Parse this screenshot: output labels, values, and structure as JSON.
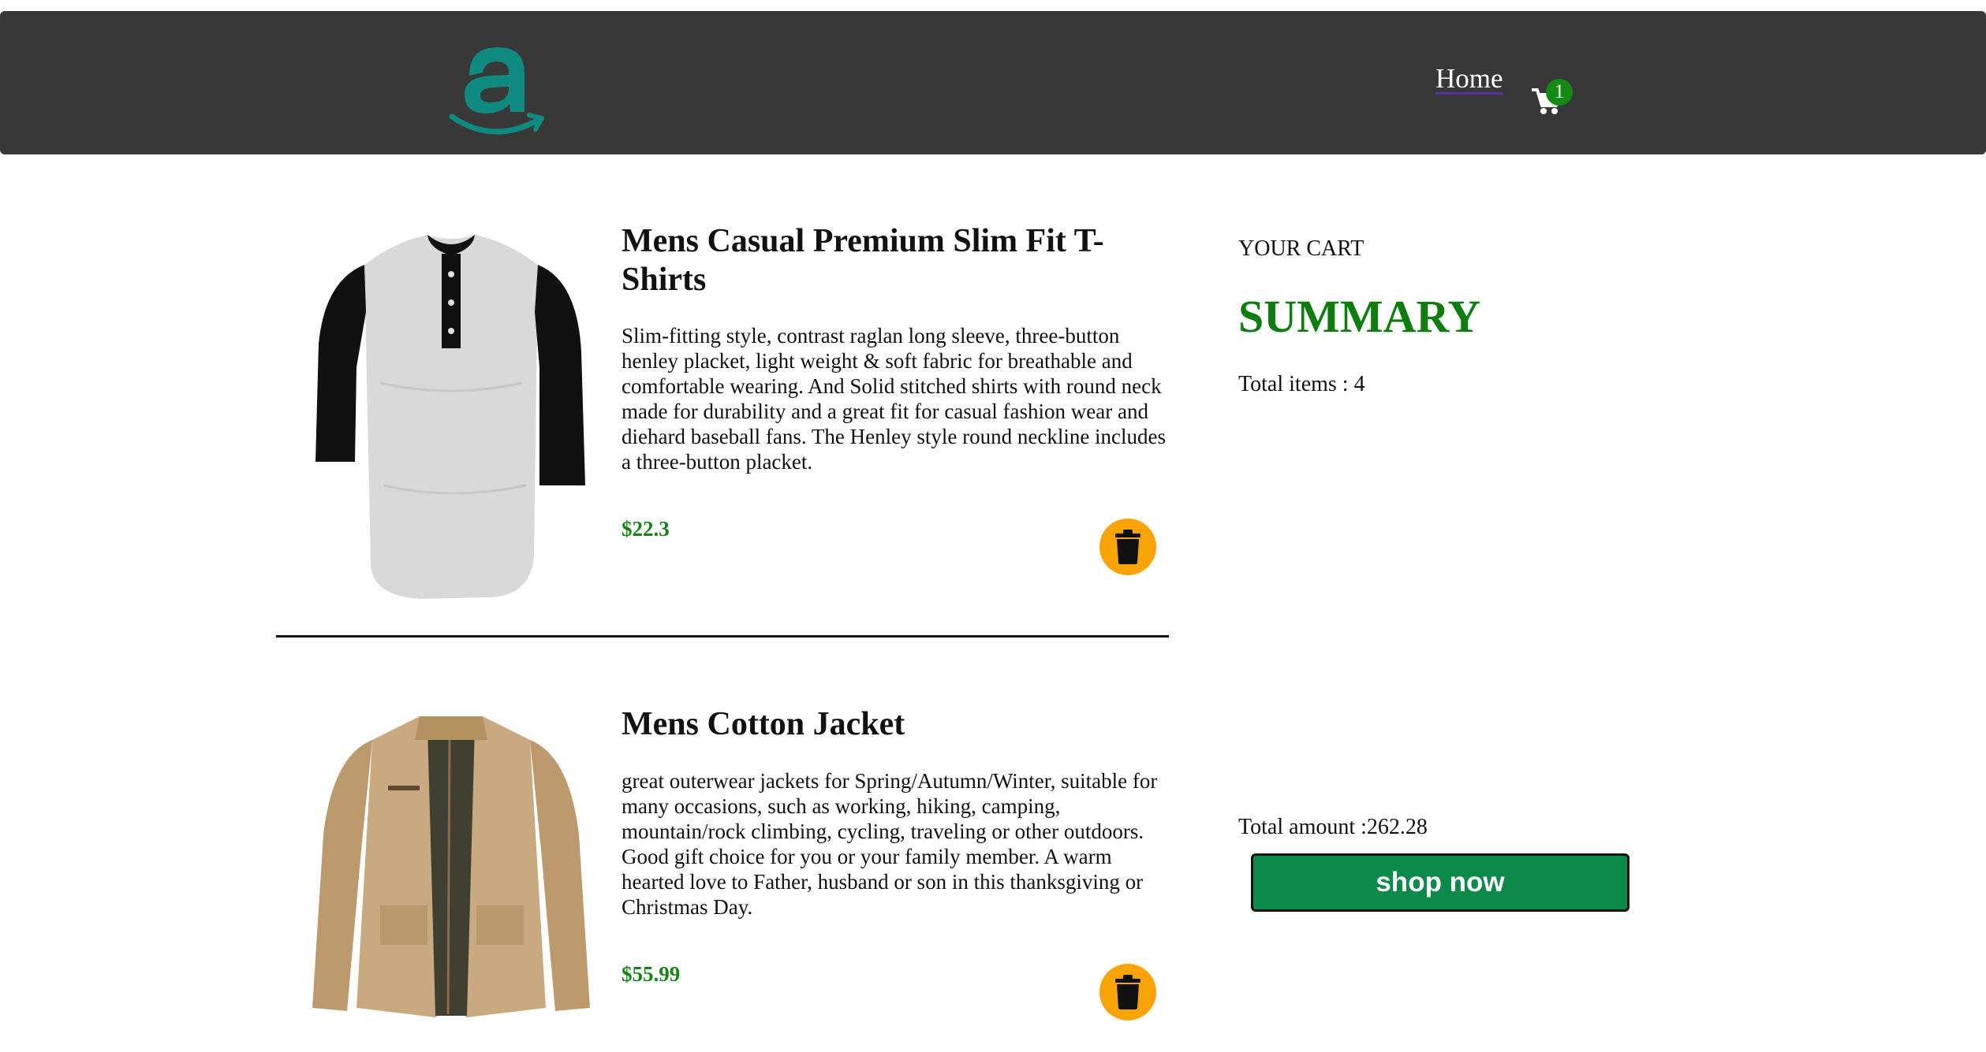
{
  "header": {
    "logo_alt": "a",
    "nav_home": "Home",
    "cart_count": "1"
  },
  "products": [
    {
      "title": "Mens Casual Premium Slim Fit T-Shirts",
      "description": "Slim-fitting style, contrast raglan long sleeve, three-button henley placket, light weight & soft fabric for breathable and comfortable wearing. And Solid stitched shirts with round neck made for durability and a great fit for casual fashion wear and diehard baseball fans. The Henley style round neckline includes a three-button placket.",
      "price": "$22.3",
      "image_icon": "raglan-henley-shirt-image"
    },
    {
      "title": "Mens Cotton Jacket",
      "description": "great outerwear jackets for Spring/Autumn/Winter, suitable for many occasions, such as working, hiking, camping, mountain/rock climbing, cycling, traveling or other outdoors. Good gift choice for you or your family member. A warm hearted love to Father, husband or son in this thanksgiving or Christmas Day.",
      "price": "$55.99",
      "image_icon": "khaki-cotton-jacket-image"
    }
  ],
  "summary": {
    "cart_label": "YOUR CART",
    "heading": "SUMMARY",
    "total_items": "Total items : 4",
    "total_amount": "Total amount :262.28",
    "shop_button": "shop now"
  },
  "colors": {
    "navbar": "#383838",
    "logo_teal": "#0f8a80",
    "price_green": "#168516",
    "summary_green": "#0e7d0e",
    "delete_orange": "#f9a406",
    "shop_button_green": "#0b8a4a",
    "badge_green": "#148a14"
  }
}
